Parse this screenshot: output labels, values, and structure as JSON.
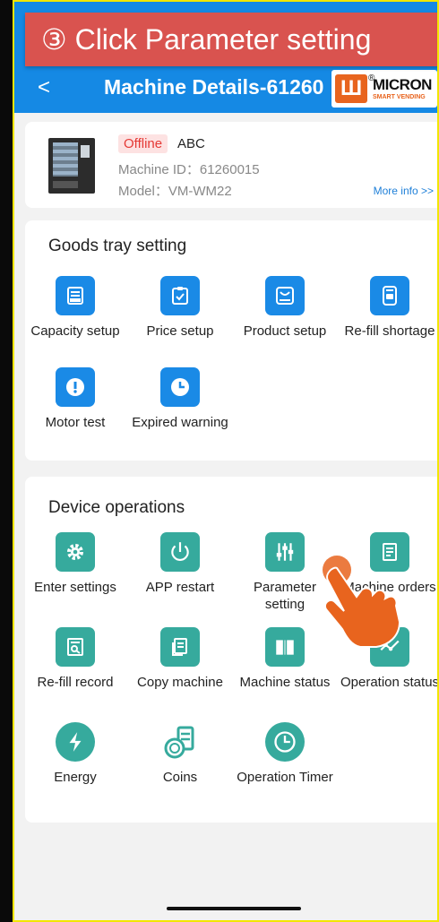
{
  "banner": {
    "text": "③ Click Parameter setting"
  },
  "header": {
    "back_symbol": "<",
    "title": "Machine Details-61260"
  },
  "logo": {
    "mark": "Ш",
    "reg": "®",
    "brand": "MICRON",
    "sub": "SMART VENDING"
  },
  "machine": {
    "status": "Offline",
    "name": "ABC",
    "id_text": "Machine ID：61260015",
    "model_text": "Model：VM-WM22",
    "more_info": "More info >>"
  },
  "goods_tray": {
    "title": "Goods tray setting",
    "items": [
      {
        "label": "Capacity setup",
        "icon": "capacity-icon"
      },
      {
        "label": "Price setup",
        "icon": "clipboard-check-icon"
      },
      {
        "label": "Product setup",
        "icon": "product-box-icon"
      },
      {
        "label": "Re-fill shortage",
        "icon": "refill-icon"
      },
      {
        "label": "Motor test",
        "icon": "alert-icon"
      },
      {
        "label": "Expired warning",
        "icon": "clock-icon"
      }
    ]
  },
  "device_ops": {
    "title": "Device operations",
    "items": [
      {
        "label": "Enter settings",
        "icon": "gear-icon"
      },
      {
        "label": "APP restart",
        "icon": "power-icon"
      },
      {
        "label": "Parameter setting",
        "icon": "sliders-icon"
      },
      {
        "label": "Machine orders",
        "icon": "orders-icon"
      },
      {
        "label": "Re-fill record",
        "icon": "record-icon"
      },
      {
        "label": "Copy machine",
        "icon": "copy-icon"
      },
      {
        "label": "Machine status",
        "icon": "book-icon"
      },
      {
        "label": "Operation status",
        "icon": "chart-icon"
      },
      {
        "label": "Energy",
        "icon": "lightning-icon"
      },
      {
        "label": "Coins",
        "icon": "coins-icon"
      },
      {
        "label": "Operation Timer",
        "icon": "timer-icon"
      }
    ]
  },
  "colors": {
    "header": "#1589e4",
    "banner": "#d9534f",
    "accent_blue": "#1a8ae6",
    "accent_teal": "#36aa9d",
    "pointer": "#e8641e"
  }
}
